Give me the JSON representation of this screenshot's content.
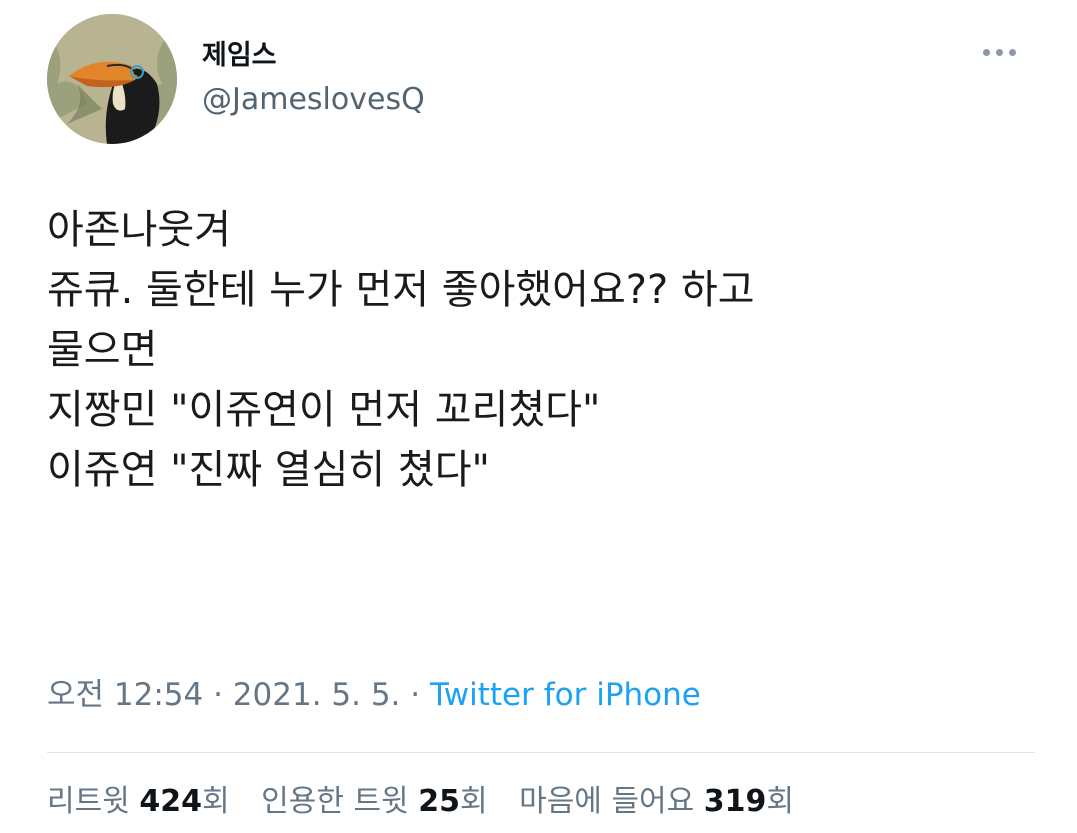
{
  "author": {
    "display_name": "제임스",
    "handle": "@JameslovesQ"
  },
  "tweet": {
    "lines": [
      "아존나웃겨",
      "쥬큐. 둘한테 누가 먼저 좋아했어요?? 하고",
      "물으면",
      "지짱민 \"이쥬연이 먼저 꼬리쳤다\"",
      "이쥬연 \"진짜 열심히 쳤다\""
    ]
  },
  "meta": {
    "time": "오전 12:54",
    "separator": " · ",
    "date": "2021. 5. 5.",
    "source": "Twitter for iPhone"
  },
  "stats": {
    "retweets": {
      "label": "리트윗 ",
      "count": "424",
      "unit": "회"
    },
    "quotes": {
      "label": "인용한 트윗 ",
      "count": "25",
      "unit": "회"
    },
    "likes": {
      "label": "마음에 들어요 ",
      "count": "319",
      "unit": "회"
    }
  },
  "icons": {
    "avatar": "toucan-avatar",
    "more": "more-options-icon"
  }
}
